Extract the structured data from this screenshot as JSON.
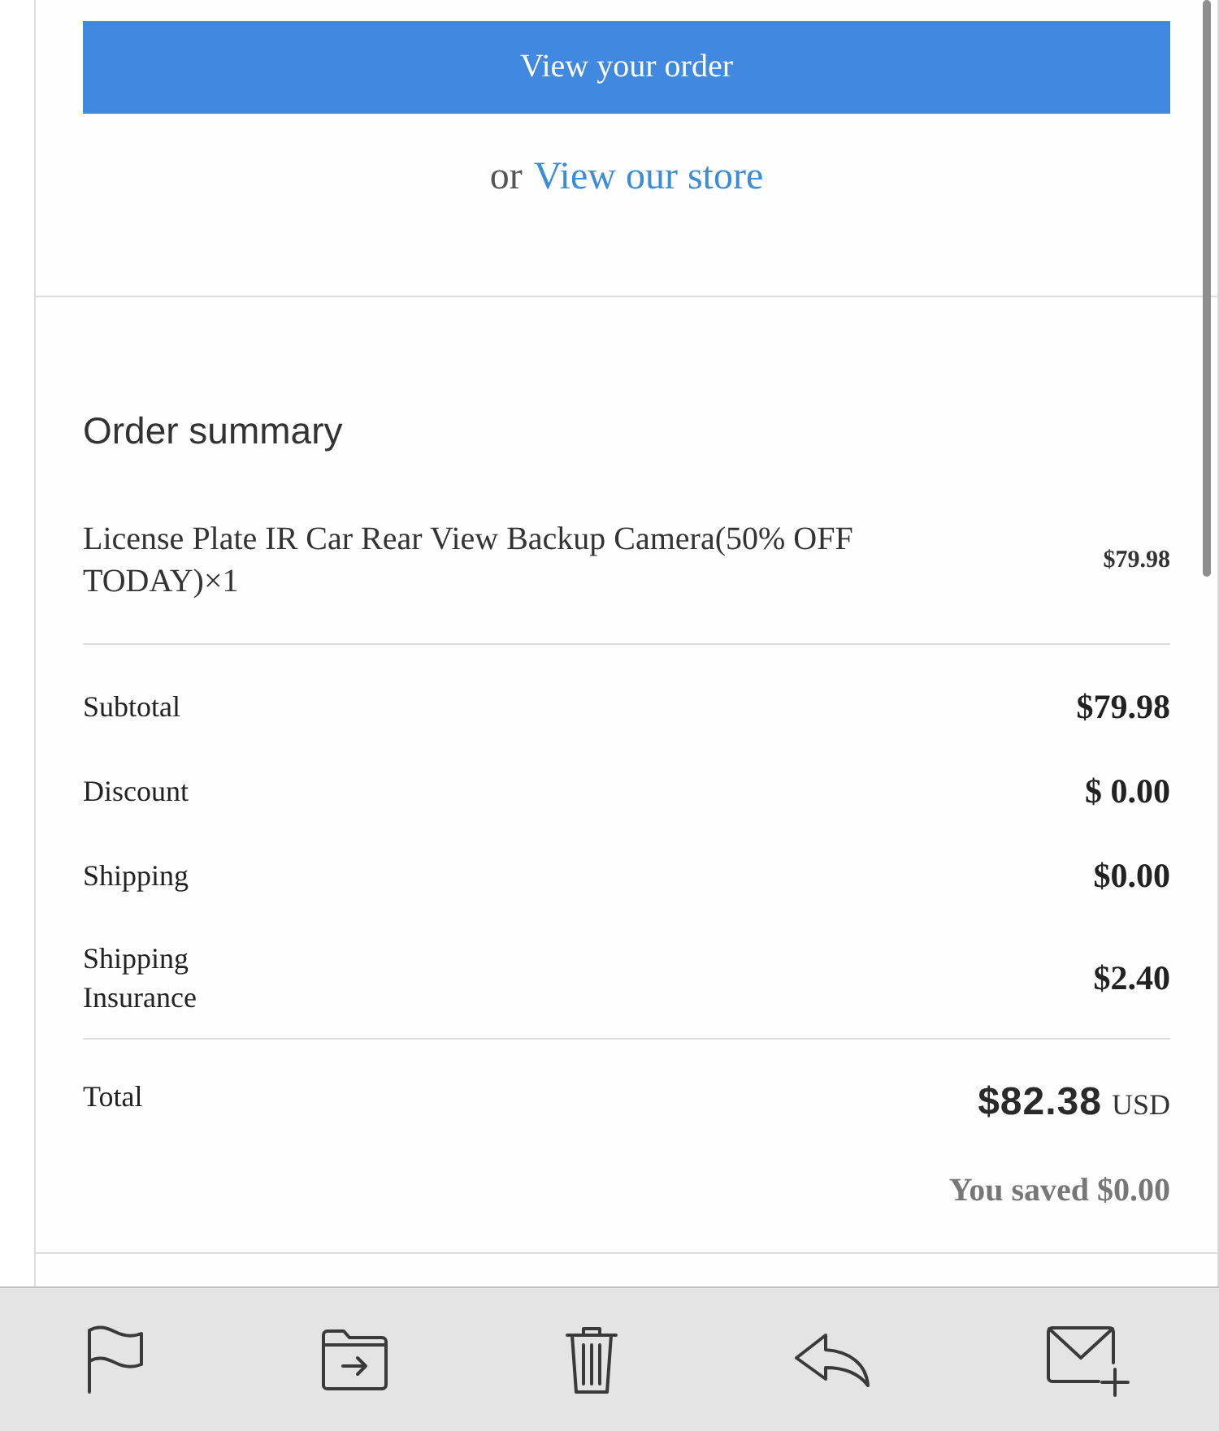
{
  "actions": {
    "primary_button": "View your order",
    "secondary_prefix": "or",
    "secondary_link": "View our store"
  },
  "order_summary": {
    "title": "Order summary",
    "items": [
      {
        "name": "License Plate IR Car Rear View Backup Camera(50% OFF TODAY)×1",
        "price": "$79.98"
      }
    ],
    "lines": [
      {
        "label": "Subtotal",
        "value": "$79.98"
      },
      {
        "label": "Discount",
        "value": "$ 0.00"
      },
      {
        "label": "Shipping",
        "value": "$0.00"
      },
      {
        "label": "Shipping Insurance",
        "value": "$2.40"
      }
    ],
    "total": {
      "label": "Total",
      "amount": "$82.38",
      "currency": "USD",
      "savings": "You saved $0.00"
    }
  }
}
